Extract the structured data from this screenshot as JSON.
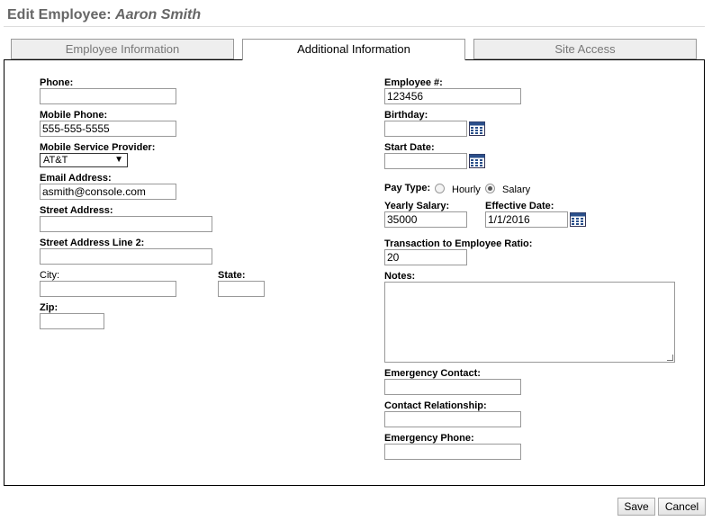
{
  "header": {
    "title_prefix": "Edit Employee:",
    "employee_name": "Aaron Smith"
  },
  "tabs": [
    {
      "label": "Employee Information",
      "active": false
    },
    {
      "label": "Additional Information",
      "active": true
    },
    {
      "label": "Site Access",
      "active": false
    }
  ],
  "left": {
    "phone": {
      "label": "Phone:",
      "value": ""
    },
    "mobile_phone": {
      "label": "Mobile Phone:",
      "value": "555-555-5555"
    },
    "provider": {
      "label": "Mobile Service Provider:",
      "value": "AT&T"
    },
    "email": {
      "label": "Email Address:",
      "value": "asmith@console.com"
    },
    "street": {
      "label": "Street Address:",
      "value": ""
    },
    "street2": {
      "label": "Street Address Line 2:",
      "value": ""
    },
    "city": {
      "label": "City:",
      "value": ""
    },
    "state": {
      "label": "State:",
      "value": ""
    },
    "zip": {
      "label": "Zip:",
      "value": ""
    }
  },
  "right": {
    "employee_number": {
      "label": "Employee #:",
      "value": "123456"
    },
    "birthday": {
      "label": "Birthday:",
      "value": ""
    },
    "start_date": {
      "label": "Start Date:",
      "value": ""
    },
    "pay_type": {
      "label": "Pay Type:",
      "options": [
        "Hourly",
        "Salary"
      ],
      "selected": "Salary"
    },
    "yearly_salary": {
      "label": "Yearly Salary:",
      "value": "35000"
    },
    "effective_date": {
      "label": "Effective Date:",
      "value": "1/1/2016"
    },
    "ratio": {
      "label": "Transaction to Employee Ratio:",
      "value": "20"
    },
    "notes": {
      "label": "Notes:",
      "value": ""
    },
    "emergency_contact": {
      "label": "Emergency Contact:",
      "value": ""
    },
    "contact_relationship": {
      "label": "Contact Relationship:",
      "value": ""
    },
    "emergency_phone": {
      "label": "Emergency Phone:",
      "value": ""
    }
  },
  "buttons": {
    "save": "Save",
    "cancel": "Cancel"
  },
  "icons": {
    "calendar": "calendar-icon",
    "dropdown": "chevron-down-icon"
  }
}
